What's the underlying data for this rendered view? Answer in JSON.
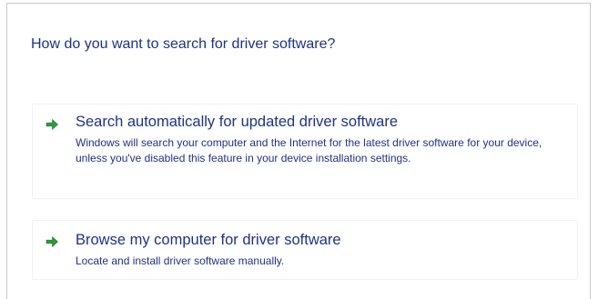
{
  "dialog": {
    "heading": "How do you want to search for driver software?",
    "accent_color": "#1e3287",
    "arrow_color": "#2f9a3c",
    "options": [
      {
        "icon": "green-arrow-icon",
        "title": "Search automatically for updated driver software",
        "description": "Windows will search your computer and the Internet for the latest driver software for your device, unless you've disabled this feature in your device installation settings."
      },
      {
        "icon": "green-arrow-icon",
        "title": "Browse my computer for driver software",
        "description": "Locate and install driver software manually."
      }
    ]
  }
}
